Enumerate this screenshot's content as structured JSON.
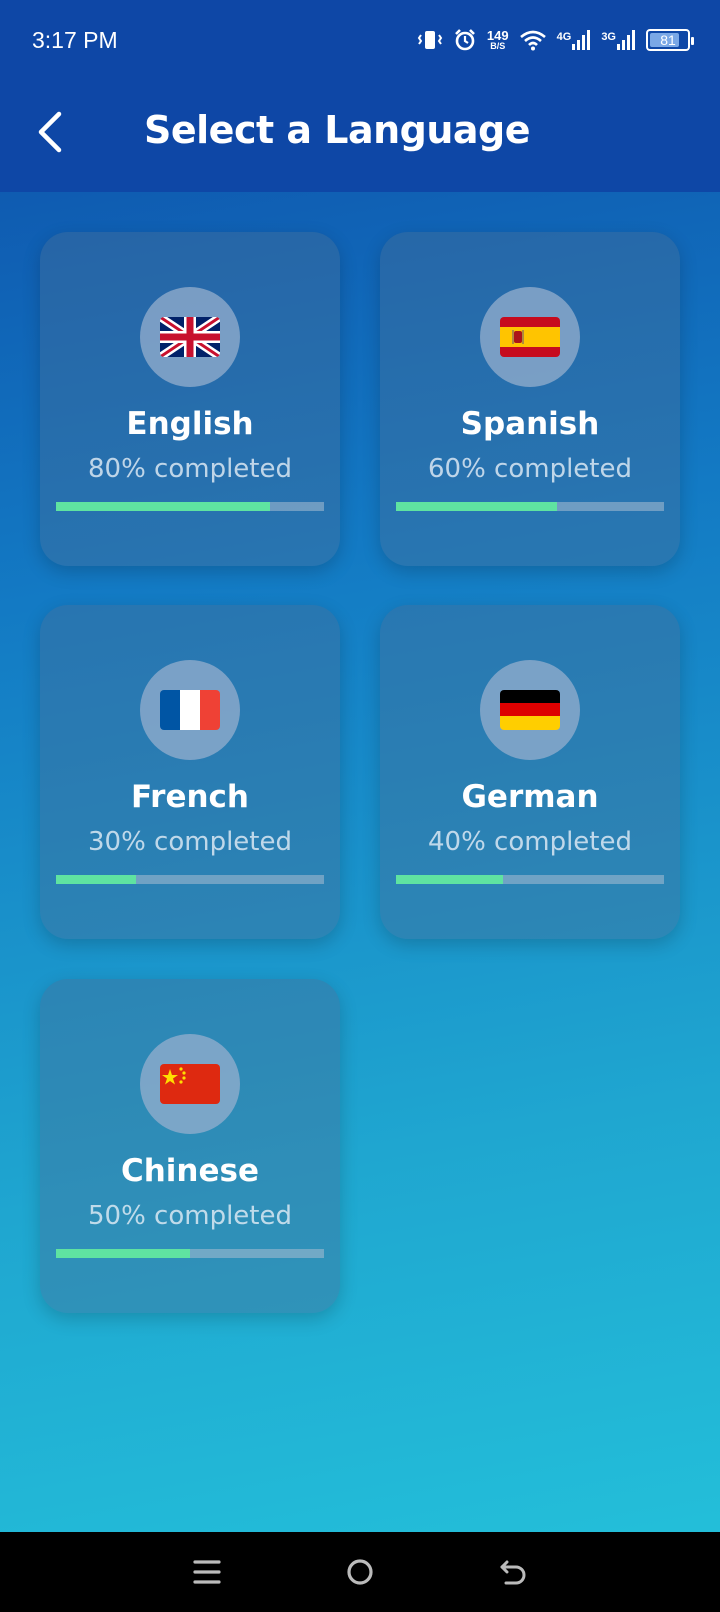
{
  "status_bar": {
    "time": "3:17 PM",
    "net_speed": "149",
    "net_unit": "B/S",
    "signal1_label": "4G",
    "signal2_label": "3G",
    "battery_level": "81",
    "battery_fraction": 0.81,
    "icons": [
      "vibrate-icon",
      "alarm-icon",
      "wifi-icon",
      "signal-icon",
      "battery-icon"
    ]
  },
  "header": {
    "title": "Select a Language",
    "back_icon": "chevron-left-icon"
  },
  "colors": {
    "header_bg": "#0e47a6",
    "progress_fill": "#5fe3a1",
    "card_bg": "rgba(70,110,150,0.42)"
  },
  "languages": [
    {
      "name": "English",
      "progress_text": "80% completed",
      "progress": 0.8,
      "flag": "uk-flag-icon"
    },
    {
      "name": "Spanish",
      "progress_text": "60% completed",
      "progress": 0.6,
      "flag": "spain-flag-icon"
    },
    {
      "name": "French",
      "progress_text": "30% completed",
      "progress": 0.3,
      "flag": "france-flag-icon"
    },
    {
      "name": "German",
      "progress_text": "40% completed",
      "progress": 0.4,
      "flag": "germany-flag-icon"
    },
    {
      "name": "Chinese",
      "progress_text": "50% completed",
      "progress": 0.5,
      "flag": "china-flag-icon"
    }
  ],
  "nav_bar": {
    "icons": [
      "menu-icon",
      "home-icon",
      "back-icon"
    ]
  }
}
